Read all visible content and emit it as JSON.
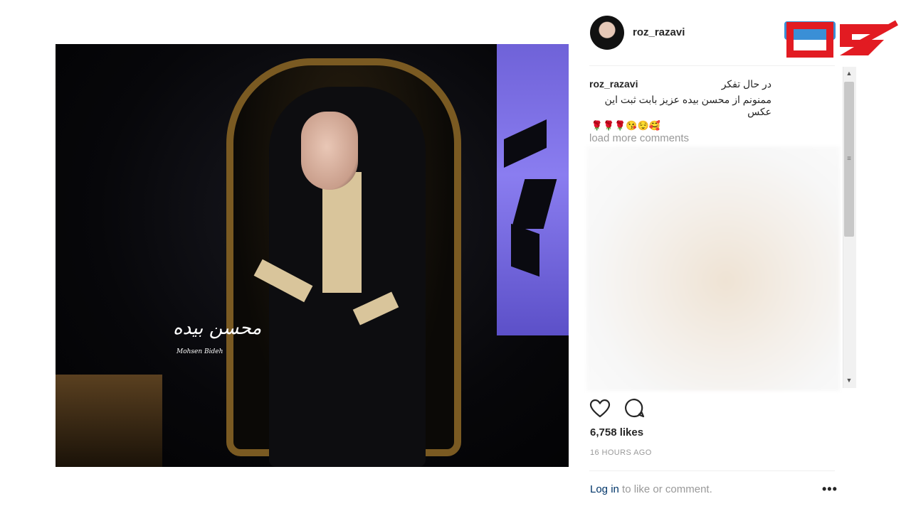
{
  "post": {
    "username": "roz_razavi",
    "caption_user": "roz_razavi",
    "caption_line1": "در حال تفکر",
    "caption_line2": "ممنونم از محسن بیده عزیز بابت ثبت این عکس",
    "caption_emojis": "🌹🌹🌹😘😌🥰",
    "load_more": "load more comments",
    "likes": "6,758 likes",
    "time": "16 HOURS AGO"
  },
  "photo": {
    "signature": "محسن بیده",
    "signature_sub": "Mohsen Bideh"
  },
  "footer": {
    "login_link": "Log in",
    "login_rest": " to like or comment.",
    "more": "•••"
  },
  "icons": {
    "like": "heart-icon",
    "comment": "comment-icon",
    "more": "more-options-icon"
  },
  "colors": {
    "link": "#003569",
    "muted": "#999999",
    "watermark_red": "#e21b22",
    "watermark_blue": "#3a8fd6"
  }
}
